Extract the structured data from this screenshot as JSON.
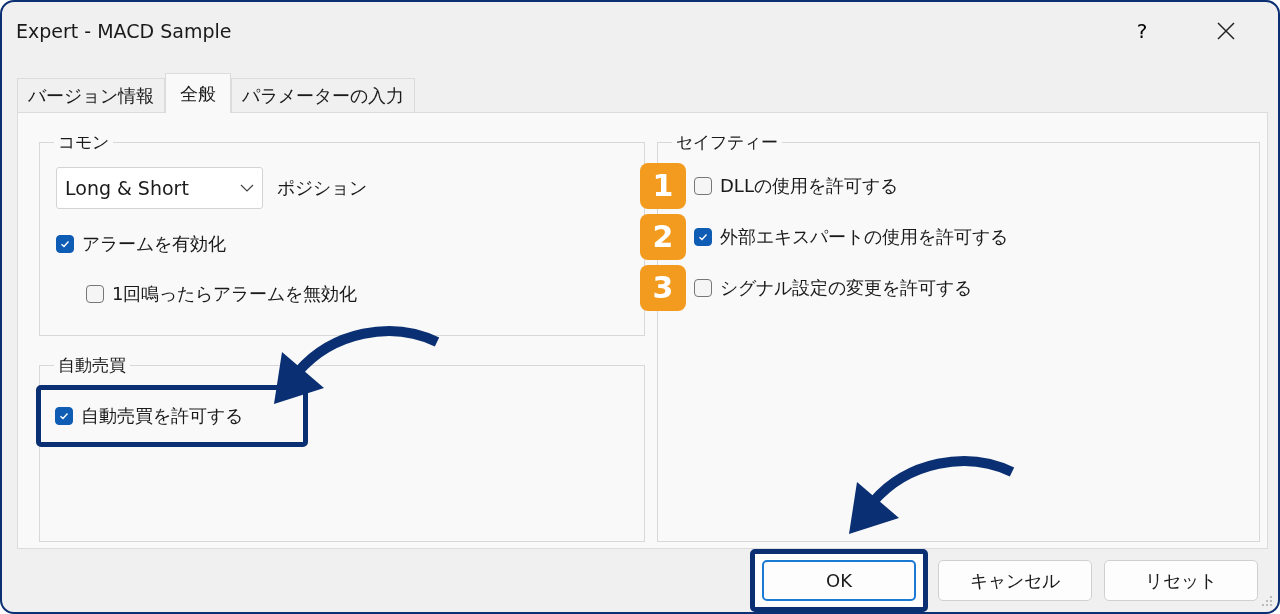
{
  "window": {
    "title": "Expert - MACD Sample",
    "help": "?"
  },
  "tabs": [
    {
      "label": "バージョン情報",
      "selected": false
    },
    {
      "label": "全般",
      "selected": true
    },
    {
      "label": "パラメーターの入力",
      "selected": false
    }
  ],
  "common": {
    "title": "コモン",
    "dropdown": {
      "value": "Long & Short",
      "label": "ポジション"
    },
    "checkboxes": [
      {
        "label": "アラームを有効化",
        "checked": true,
        "children": [
          {
            "label": "1回鳴ったらアラームを無効化",
            "checked": false
          }
        ]
      }
    ]
  },
  "auto_trading": {
    "title": "自動売買",
    "checkbox": {
      "label": "自動売買を許可する",
      "checked": true,
      "highlighted": true
    }
  },
  "safety": {
    "title": "セイフティー",
    "items": [
      {
        "badge": "1",
        "label": "DLLの使用を許可する",
        "checked": false
      },
      {
        "badge": "2",
        "label": "外部エキスパートの使用を許可する",
        "checked": true
      },
      {
        "badge": "3",
        "label": "シグナル設定の変更を許可する",
        "checked": false
      }
    ]
  },
  "buttons": [
    {
      "label": "OK",
      "default": true,
      "highlighted": true
    },
    {
      "label": "キャンセル",
      "default": false,
      "highlighted": false
    },
    {
      "label": "リセット",
      "default": false,
      "highlighted": false
    }
  ]
}
